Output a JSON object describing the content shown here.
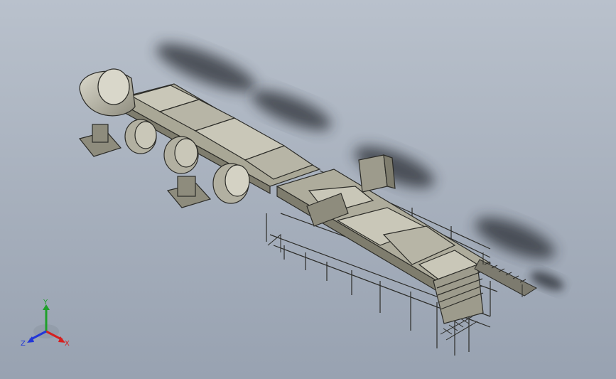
{
  "scene": {
    "subject": "roll-fed-production-line-3d-model",
    "colors": {
      "background_top": "#b9c1cc",
      "background_bottom": "#98a2b1",
      "machine_fill": "#a9a796",
      "machine_light": "#c9c7b8",
      "machine_dark": "#7f7d6e",
      "edge": "#2c2c28",
      "shadow": "#2a2e36"
    }
  },
  "triad": {
    "x_label": "X",
    "y_label": "Y",
    "z_label": "Z",
    "x_color": "#d62020",
    "y_color": "#1fa02b",
    "z_color": "#2236d8"
  }
}
